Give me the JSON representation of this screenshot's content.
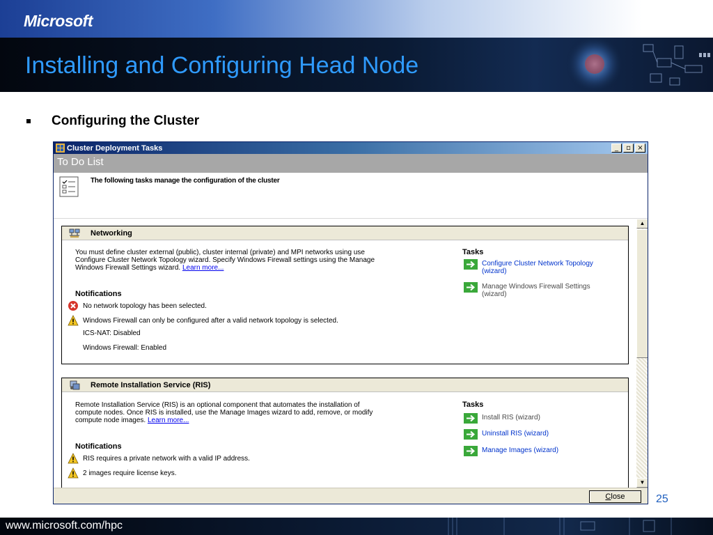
{
  "slide": {
    "brand": "Microsoft",
    "title": "Installing and Configuring Head Node",
    "bullet": "Configuring the Cluster",
    "page_number": "25",
    "footer_url": "www.microsoft.com/hpc"
  },
  "window": {
    "title": "Cluster Deployment Tasks",
    "controls": [
      "_",
      "▫",
      "×"
    ],
    "band_title": "To Do List",
    "intro_text": "The following tasks manage the configuration of the cluster",
    "close_label": "Close",
    "sections": [
      {
        "title": "Networking",
        "icon": "network-icon",
        "description_lines": [
          "You must define cluster external (public), cluster internal (private) and MPI networks using use",
          "Configure Cluster Network Topology wizard. Specify Windows Firewall settings using the Manage",
          "Windows Firewall Settings wizard."
        ],
        "learn_more": "Learn more...",
        "notifications_label": "Notifications",
        "notifications": [
          {
            "type": "error",
            "icon": "error-icon",
            "text": "No network topology has been selected."
          },
          {
            "type": "warning",
            "icon": "warning-icon",
            "text": "Windows Firewall can only be configured after a valid network topology is selected."
          },
          {
            "type": "info",
            "text": "ICS-NAT: Disabled"
          },
          {
            "type": "info",
            "text": "Windows Firewall: Enabled"
          }
        ],
        "tasks_label": "Tasks",
        "tasks": [
          {
            "label": "Configure Cluster Network Topology (wizard)",
            "enabled": true
          },
          {
            "label": "Manage Windows Firewall Settings (wizard)",
            "enabled": false
          }
        ]
      },
      {
        "title": "Remote Installation Service (RIS)",
        "icon": "server-icon",
        "description_lines": [
          "Remote Installation Service (RIS) is an optional component that automates the installation of",
          "compute nodes. Once RIS is installed, use the Manage Images wizard to add, remove, or modify",
          "compute node images."
        ],
        "learn_more": "Learn more...",
        "notifications_label": "Notifications",
        "notifications": [
          {
            "type": "warning",
            "icon": "warning-icon",
            "text": "RIS requires a private network with a valid IP address."
          },
          {
            "type": "warning",
            "icon": "warning-icon",
            "text": "2 images require license keys."
          }
        ],
        "tasks_label": "Tasks",
        "tasks": [
          {
            "label": "Install RIS (wizard)",
            "enabled": false
          },
          {
            "label": "Uninstall RIS (wizard)",
            "enabled": true
          },
          {
            "label": "Manage Images (wizard)",
            "enabled": true
          }
        ]
      }
    ]
  },
  "colors": {
    "title_blue": "#2f9bff",
    "link_blue": "#0033cc",
    "task_arrow_green": "#3aa83a",
    "header_dark": "#0a1a33"
  }
}
